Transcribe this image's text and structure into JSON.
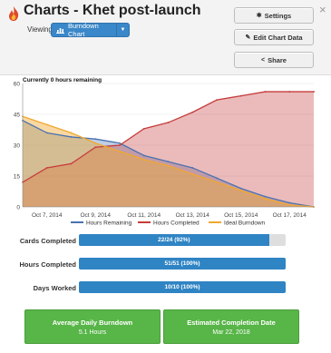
{
  "header": {
    "title": "Charts - Khet post-launch",
    "viewing_label": "Viewing",
    "view_select": "Burndown Chart",
    "close": "×",
    "buttons": {
      "settings": "Settings",
      "edit": "Edit Chart Data",
      "share": "Share"
    }
  },
  "chart_data": {
    "type": "line",
    "title": "Currently 0 hours remaining",
    "ylim": [
      0,
      60
    ],
    "yticks": [
      0,
      15,
      30,
      45,
      60
    ],
    "xticks": [
      "Oct 7, 2014",
      "Oct 9, 2014",
      "Oct 11, 2014",
      "Oct 13, 2014",
      "Oct 15, 2014",
      "Oct 17, 2014"
    ],
    "x": [
      "Oct 6",
      "Oct 7",
      "Oct 8",
      "Oct 9",
      "Oct 10",
      "Oct 11",
      "Oct 12",
      "Oct 13",
      "Oct 14",
      "Oct 15",
      "Oct 16",
      "Oct 17",
      "Oct 18"
    ],
    "series": [
      {
        "name": "Hours Remaining",
        "color": "#4a72b0",
        "values": [
          42,
          36,
          34,
          33,
          31,
          25,
          22,
          19,
          14,
          9,
          5,
          2,
          0
        ]
      },
      {
        "name": "Hours Completed",
        "color": "#c63c3c",
        "values": [
          12,
          19,
          21,
          29,
          30,
          38,
          41,
          46,
          52,
          54,
          56,
          56,
          56
        ]
      },
      {
        "name": "Ideal Burndown",
        "color": "#f0a830",
        "values": [
          44,
          40,
          36,
          31,
          27,
          23,
          20,
          16,
          12,
          8,
          4,
          1,
          0
        ]
      }
    ]
  },
  "progress": [
    {
      "label": "Cards Completed",
      "text": "22/24 (92%)",
      "fraction": 0.92
    },
    {
      "label": "Hours Completed",
      "text": "51/51 (100%)",
      "fraction": 1.0
    },
    {
      "label": "Days Worked",
      "text": "10/10 (100%)",
      "fraction": 1.0
    }
  ],
  "cards": {
    "avg_title": "Average Daily Burndown",
    "avg_value": "5.1 Hours",
    "est_title": "Estimated Completion Date",
    "est_value": "Mar 22, 2018"
  }
}
